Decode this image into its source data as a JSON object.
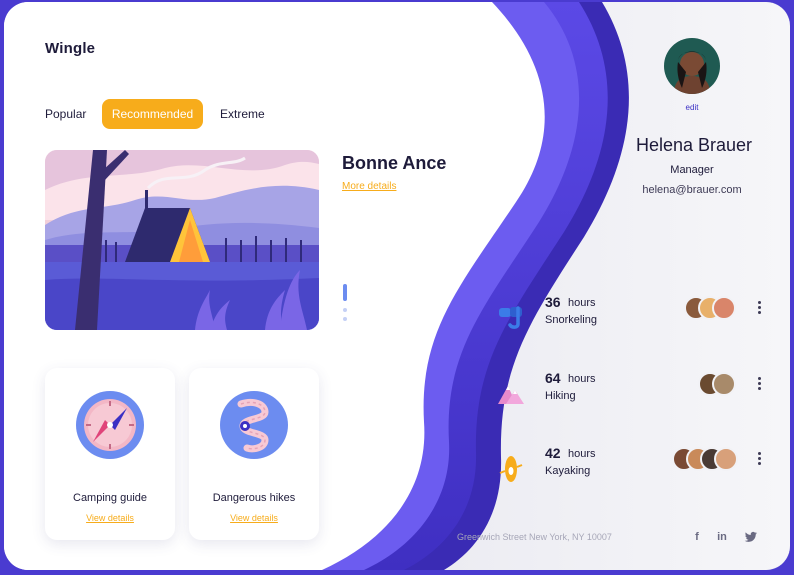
{
  "app": {
    "brand": "Wingle"
  },
  "tabs": [
    {
      "label": "Popular"
    },
    {
      "label": "Recommended",
      "active": true
    },
    {
      "label": "Extreme"
    }
  ],
  "featured": {
    "title": "Bonne Ance",
    "link": "More details",
    "slides": {
      "total": 3,
      "active": 1
    }
  },
  "cards": [
    {
      "title": "Camping guide",
      "link": "View details",
      "icon": "compass-icon"
    },
    {
      "title": "Dangerous hikes",
      "link": "View details",
      "icon": "trail-route-icon"
    }
  ],
  "profile": {
    "edit_label": "edit",
    "name": "Helena Brauer",
    "role": "Manager",
    "email": "helena@brauer.com"
  },
  "activities": [
    {
      "hours": "36",
      "unit": "hours",
      "name": "Snorkeling",
      "icon": "snorkel-icon",
      "participants": 3
    },
    {
      "hours": "64",
      "unit": "hours",
      "name": "Hiking",
      "icon": "mountain-icon",
      "participants": 2
    },
    {
      "hours": "42",
      "unit": "hours",
      "name": "Kayaking",
      "icon": "kayak-icon",
      "participants": 4
    }
  ],
  "footer": {
    "address": "Greenwich Street New York, NY 10007",
    "social": {
      "facebook": "f",
      "linkedin": "in",
      "twitter": "twitter-icon"
    }
  },
  "colors": {
    "accent": "#f7ac1b",
    "wave_primary": "#4a3bd0",
    "wave_secondary": "#6c5cf0",
    "text_dark": "#1e1b3a"
  }
}
